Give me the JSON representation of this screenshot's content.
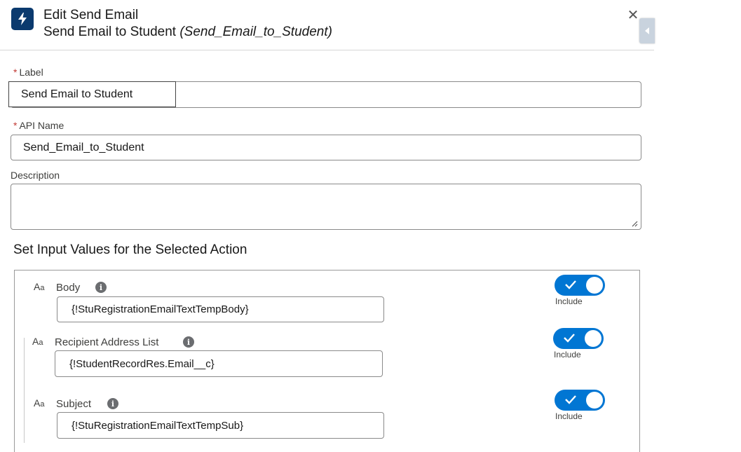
{
  "header": {
    "title": "Edit Send Email",
    "subtitle_label": "Send Email to Student",
    "subtitle_api": "(Send_Email_to_Student)",
    "close_symbol": "✕",
    "icon": "lightning-bolt-icon"
  },
  "form": {
    "label_field": {
      "label": "Label",
      "required_mark": "*",
      "value": "Send Email to Student"
    },
    "api_name_field": {
      "label": "API Name",
      "required_mark": "*",
      "value": "Send_Email_to_Student"
    },
    "description_field": {
      "label": "Description",
      "value": ""
    }
  },
  "inputs_section": {
    "title": "Set Input Values for the Selected Action",
    "rows": [
      {
        "type_glyph": "A",
        "type_glyph_sub": "a",
        "name": "Body",
        "value": "{!StuRegistrationEmailTextTempBody}",
        "include_label": "Include",
        "include_on": true
      },
      {
        "type_glyph": "A",
        "type_glyph_sub": "a",
        "name": "Recipient Address List",
        "value": "{!StudentRecordRes.Email__c}",
        "include_label": "Include",
        "include_on": true
      },
      {
        "type_glyph": "A",
        "type_glyph_sub": "a",
        "name": "Subject",
        "value": "{!StuRegistrationEmailTextTempSub}",
        "include_label": "Include",
        "include_on": true
      }
    ]
  },
  "colors": {
    "header_icon_bg": "#0b3a6e",
    "toggle_on": "#0176d3",
    "required": "#c23934"
  }
}
